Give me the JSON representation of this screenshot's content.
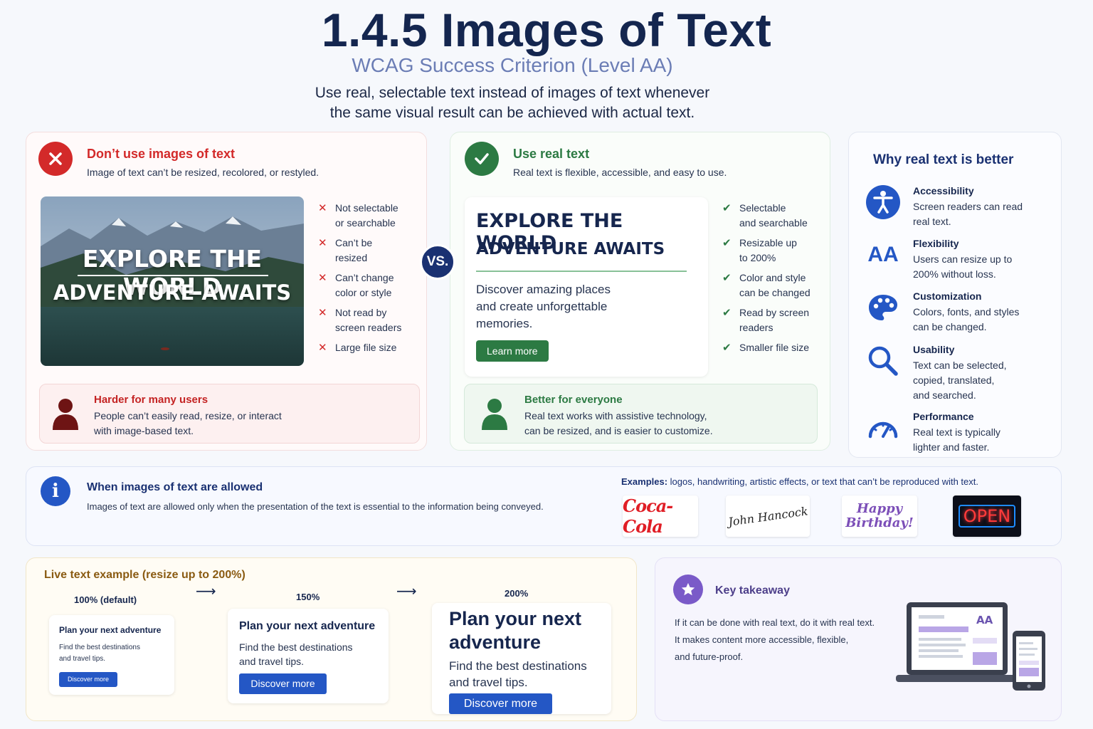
{
  "header": {
    "title": "1.4.5 Images of Text",
    "subtitle": "WCAG Success Criterion (Level AA)",
    "intro_line1": "Use real, selectable text instead of images of text whenever",
    "intro_line2": "the same visual result can be achieved with actual text."
  },
  "bad": {
    "title": "Don’t use images of text",
    "subtitle": "Image of text can’t be resized, recolored, or restyled.",
    "image_text_line1": "EXPLORE THE WORLD",
    "image_text_line2": "ADVENTURE AWAITS",
    "items": [
      {
        "line1": "Not selectable",
        "line2": "or searchable"
      },
      {
        "line1": "Can’t be",
        "line2": "resized"
      },
      {
        "line1": "Can’t change",
        "line2": "color or style"
      },
      {
        "line1": "Not read by",
        "line2": "screen readers"
      },
      {
        "line1": "Large file size",
        "line2": ""
      }
    ],
    "note_title": "Harder for many users",
    "note_line1": "People can’t easily read, resize, or interact",
    "note_line2": "with image-based text."
  },
  "vs": "VS.",
  "good": {
    "title": "Use real text",
    "subtitle": "Real text is flexible, accessible, and easy to use.",
    "sample_h1": "EXPLORE THE WORLD",
    "sample_h2": "ADVENTURE AWAITS",
    "sample_body_line1": "Discover amazing places",
    "sample_body_line2": "and create unforgettable",
    "sample_body_line3": "memories.",
    "sample_button": "Learn more",
    "items": [
      {
        "line1": "Selectable",
        "line2": "and searchable"
      },
      {
        "line1": "Resizable up",
        "line2": "to 200%"
      },
      {
        "line1": "Color and style",
        "line2": "can be changed"
      },
      {
        "line1": "Read by screen",
        "line2": "readers"
      },
      {
        "line1": "Smaller file size",
        "line2": ""
      }
    ],
    "note_title": "Better for everyone",
    "note_line1": "Real text works with assistive technology,",
    "note_line2": "can be resized, and is easier to customize."
  },
  "why": {
    "title": "Why real text is better",
    "items": [
      {
        "icon": "accessibility-icon",
        "heading": "Accessibility",
        "line1": "Screen readers can read",
        "line2": "real text.",
        "line3": ""
      },
      {
        "icon": "text-size-icon",
        "icon_text": "AA",
        "heading": "Flexibility",
        "line1": "Users can resize up to",
        "line2": "200% without loss.",
        "line3": ""
      },
      {
        "icon": "palette-icon",
        "heading": "Customization",
        "line1": "Colors, fonts, and styles",
        "line2": "can be changed.",
        "line3": ""
      },
      {
        "icon": "search-icon",
        "heading": "Usability",
        "line1": "Text can be selected,",
        "line2": "copied, translated,",
        "line3": "and searched."
      },
      {
        "icon": "gauge-icon",
        "heading": "Performance",
        "line1": "Real text is typically",
        "line2": "lighter and faster.",
        "line3": ""
      }
    ]
  },
  "allowed": {
    "title": "When images of text are allowed",
    "text": "Images of text are allowed only when the presentation of the text is essential to the information being conveyed.",
    "examples_label": "Examples:",
    "examples_text": "logos, handwriting, artistic effects, or text that can’t be reproduced with text.",
    "logos": [
      "Coca-Cola",
      "John Hancock",
      "Happy",
      "Birthday!",
      "OPEN"
    ]
  },
  "live": {
    "title": "Live text example (resize up to  200%)",
    "scales": [
      "100% (default)",
      "150%",
      "200%"
    ],
    "demo_heading": "Plan your next adventure",
    "demo_heading_200_line1": "Plan your next",
    "demo_heading_200_line2": "adventure",
    "demo_text_line1": "Find the best destinations",
    "demo_text_line2": "and travel tips.",
    "demo_button": "Discover more"
  },
  "takeaway": {
    "title": "Key takeaway",
    "line1": "If it can be done with real text, do it with real text.",
    "line2": "It makes content more accessible, flexible,",
    "line3": "and future-proof.",
    "device_text": "AA"
  },
  "colors": {
    "navy": "#14264f",
    "bad_red": "#d32a2a",
    "good_green": "#2c7a43",
    "info_blue": "#2457c5",
    "takeaway_purple": "#7a5ac8",
    "live_brown": "#8a5b12"
  }
}
